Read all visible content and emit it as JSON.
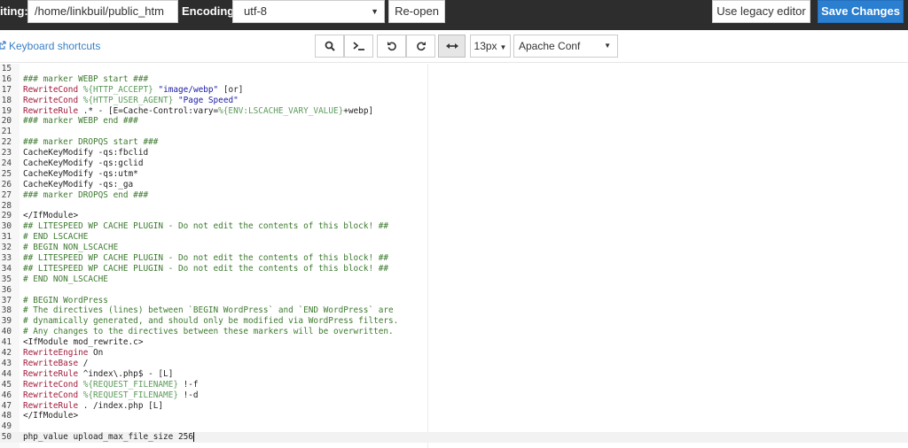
{
  "header": {
    "editing_label": "iting:",
    "path": "/home/linkbuil/public_htm",
    "encoding_label": "Encoding:",
    "encoding_value": "utf-8",
    "reopen_label": "Re-open",
    "legacy_label": "Use legacy editor",
    "save_label": "Save Changes"
  },
  "toolbar": {
    "shortcuts_label": "Keyboard shortcuts",
    "font_size": "13px",
    "mode": "Apache Conf"
  },
  "colors": {
    "topbar": "#2d2d2d",
    "primary": "#2b7fd1",
    "link": "#3a7fc6",
    "comment": "#3d7a2f",
    "directive": "#a11a3b",
    "string": "#1a1aa6"
  },
  "editor": {
    "lines": [
      {
        "num": "15",
        "seg": []
      },
      {
        "num": "16",
        "seg": [
          [
            "c",
            "### marker WEBP start ###"
          ]
        ]
      },
      {
        "num": "17",
        "seg": [
          [
            "d",
            "RewriteCond"
          ],
          [
            "p",
            " "
          ],
          [
            "v",
            "%{HTTP_ACCEPT}"
          ],
          [
            "p",
            " "
          ],
          [
            "s",
            "\"image/webp\""
          ],
          [
            "p",
            " [or]"
          ]
        ]
      },
      {
        "num": "18",
        "seg": [
          [
            "d",
            "RewriteCond"
          ],
          [
            "p",
            " "
          ],
          [
            "v",
            "%{HTTP_USER_AGENT}"
          ],
          [
            "p",
            " "
          ],
          [
            "s",
            "\"Page Speed\""
          ]
        ]
      },
      {
        "num": "19",
        "seg": [
          [
            "d",
            "RewriteRule"
          ],
          [
            "p",
            " .* - [E=Cache-Control:vary="
          ],
          [
            "v",
            "%{ENV:LSCACHE_VARY_VALUE}"
          ],
          [
            "p",
            "+webp]"
          ]
        ]
      },
      {
        "num": "20",
        "seg": [
          [
            "c",
            "### marker WEBP end ###"
          ]
        ]
      },
      {
        "num": "21",
        "seg": []
      },
      {
        "num": "22",
        "seg": [
          [
            "c",
            "### marker DROPQS start ###"
          ]
        ]
      },
      {
        "num": "23",
        "seg": [
          [
            "p",
            "CacheKeyModify -qs:fbclid"
          ]
        ]
      },
      {
        "num": "24",
        "seg": [
          [
            "p",
            "CacheKeyModify -qs:gclid"
          ]
        ]
      },
      {
        "num": "25",
        "seg": [
          [
            "p",
            "CacheKeyModify -qs:utm*"
          ]
        ]
      },
      {
        "num": "26",
        "seg": [
          [
            "p",
            "CacheKeyModify -qs:_ga"
          ]
        ]
      },
      {
        "num": "27",
        "seg": [
          [
            "c",
            "### marker DROPQS end ###"
          ]
        ]
      },
      {
        "num": "28",
        "seg": []
      },
      {
        "num": "29",
        "seg": [
          [
            "p",
            "</IfModule>"
          ]
        ]
      },
      {
        "num": "30",
        "seg": [
          [
            "c",
            "## LITESPEED WP CACHE PLUGIN - Do not edit the contents of this block! ##"
          ]
        ]
      },
      {
        "num": "31",
        "seg": [
          [
            "c",
            "# END LSCACHE"
          ]
        ]
      },
      {
        "num": "32",
        "seg": [
          [
            "c",
            "# BEGIN NON_LSCACHE"
          ]
        ]
      },
      {
        "num": "33",
        "seg": [
          [
            "c",
            "## LITESPEED WP CACHE PLUGIN - Do not edit the contents of this block! ##"
          ]
        ]
      },
      {
        "num": "34",
        "seg": [
          [
            "c",
            "## LITESPEED WP CACHE PLUGIN - Do not edit the contents of this block! ##"
          ]
        ]
      },
      {
        "num": "35",
        "seg": [
          [
            "c",
            "# END NON_LSCACHE"
          ]
        ]
      },
      {
        "num": "36",
        "seg": []
      },
      {
        "num": "37",
        "seg": [
          [
            "c",
            "# BEGIN WordPress"
          ]
        ]
      },
      {
        "num": "38",
        "seg": [
          [
            "c",
            "# The directives (lines) between `BEGIN WordPress` and `END WordPress` are"
          ]
        ]
      },
      {
        "num": "39",
        "seg": [
          [
            "c",
            "# dynamically generated, and should only be modified via WordPress filters."
          ]
        ]
      },
      {
        "num": "40",
        "seg": [
          [
            "c",
            "# Any changes to the directives between these markers will be overwritten."
          ]
        ]
      },
      {
        "num": "41",
        "seg": [
          [
            "p",
            "<IfModule mod_rewrite.c>"
          ]
        ]
      },
      {
        "num": "42",
        "seg": [
          [
            "d",
            "RewriteEngine"
          ],
          [
            "p",
            " On"
          ]
        ]
      },
      {
        "num": "43",
        "seg": [
          [
            "d",
            "RewriteBase"
          ],
          [
            "p",
            " /"
          ]
        ]
      },
      {
        "num": "44",
        "seg": [
          [
            "d",
            "RewriteRule"
          ],
          [
            "p",
            " ^index\\.php$ - [L]"
          ]
        ]
      },
      {
        "num": "45",
        "seg": [
          [
            "d",
            "RewriteCond"
          ],
          [
            "p",
            " "
          ],
          [
            "v",
            "%{REQUEST_FILENAME}"
          ],
          [
            "p",
            " !-f"
          ]
        ]
      },
      {
        "num": "46",
        "seg": [
          [
            "d",
            "RewriteCond"
          ],
          [
            "p",
            " "
          ],
          [
            "v",
            "%{REQUEST_FILENAME}"
          ],
          [
            "p",
            " !-d"
          ]
        ]
      },
      {
        "num": "47",
        "seg": [
          [
            "d",
            "RewriteRule"
          ],
          [
            "p",
            " . /index.php [L]"
          ]
        ]
      },
      {
        "num": "48",
        "seg": [
          [
            "p",
            "</IfModule>"
          ]
        ]
      },
      {
        "num": "49",
        "seg": []
      },
      {
        "num": "50",
        "seg": [
          [
            "p",
            "php_value upload_max_file_size 256"
          ]
        ],
        "current": true
      }
    ]
  }
}
